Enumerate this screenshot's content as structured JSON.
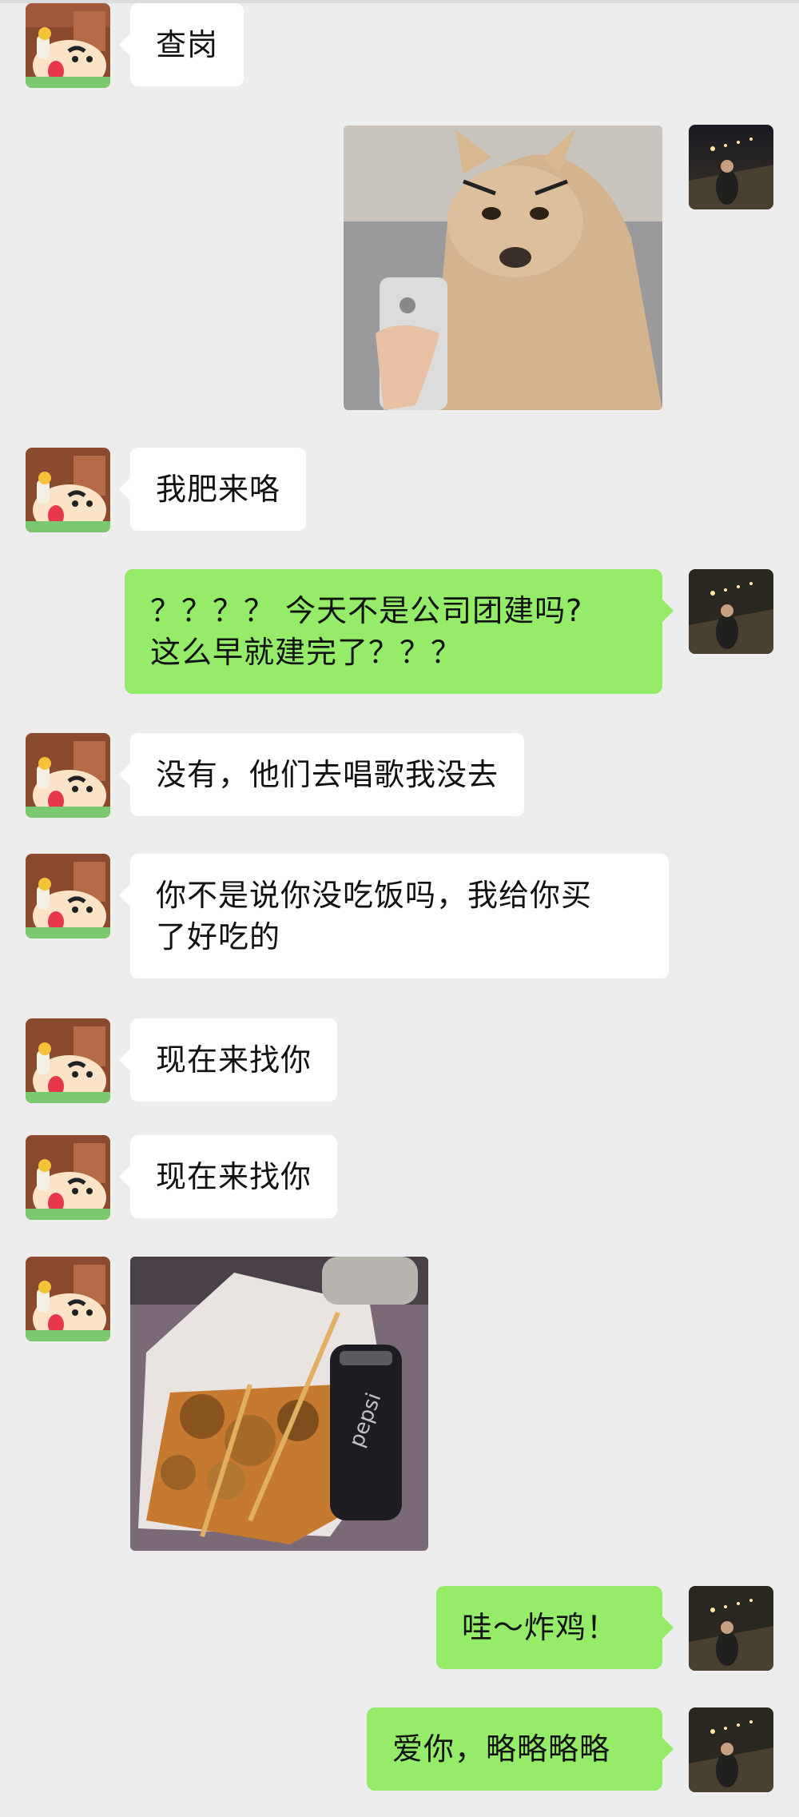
{
  "chat": {
    "messages": [
      {
        "id": "m1",
        "side": "left",
        "type": "text",
        "text": "查岗"
      },
      {
        "id": "m2",
        "side": "right",
        "type": "image",
        "image": "chihuahua-phone-selfie-meme"
      },
      {
        "id": "m3",
        "side": "left",
        "type": "text",
        "text": "我肥来咯"
      },
      {
        "id": "m4",
        "side": "right",
        "type": "text",
        "lines": [
          "？？？？ 今天不是公司团建吗?",
          "这么早就建完了？？？"
        ]
      },
      {
        "id": "m5",
        "side": "left",
        "type": "text",
        "text": "没有，他们去唱歌我没去"
      },
      {
        "id": "m6",
        "side": "left",
        "type": "text",
        "lines": [
          "你不是说你没吃饭吗，我给你买",
          "了好吃的"
        ]
      },
      {
        "id": "m7",
        "side": "left",
        "type": "text",
        "text": "现在来找你"
      },
      {
        "id": "m8",
        "side": "left",
        "type": "text",
        "text": "现在来找你"
      },
      {
        "id": "m9",
        "side": "left",
        "type": "image",
        "image": "fried-chicken-and-pepsi-photo"
      },
      {
        "id": "m10",
        "side": "right",
        "type": "text",
        "text": "哇～炸鸡！"
      },
      {
        "id": "m11",
        "side": "right",
        "type": "text",
        "text": "爱你，略略略略"
      }
    ]
  },
  "avatars": {
    "left": "crayon-shinchan-avatar",
    "right": "night-street-girl-avatar"
  },
  "colors": {
    "background": "#ededed",
    "incoming_bubble": "#ffffff",
    "outgoing_bubble": "#95ec69"
  }
}
